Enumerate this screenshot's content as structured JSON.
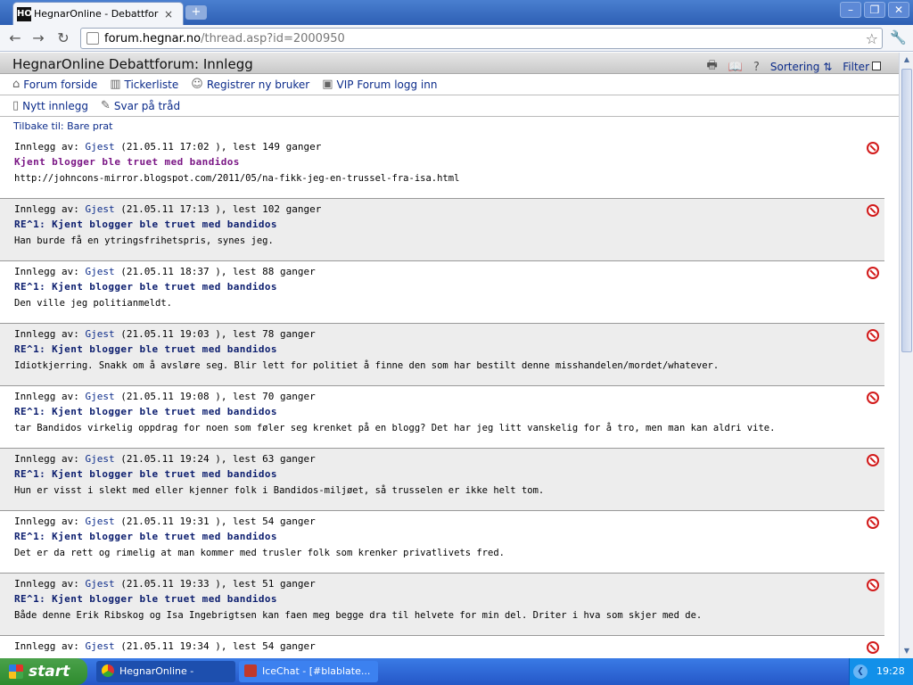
{
  "browser": {
    "tab_title": "HegnarOnline - Debattforum",
    "tab_favicon_text": "HO",
    "tab_close": "×",
    "new_tab": "+",
    "window_buttons": [
      "–",
      "❐",
      "✕"
    ],
    "back": "←",
    "forward": "→",
    "reload": "↻",
    "url_host": "forum.hegnar.no",
    "url_path": "/thread.asp?id=2000950",
    "star": "☆",
    "wrench": "🔧"
  },
  "forum": {
    "title": "HegnarOnline Debattforum: Innlegg",
    "sort_label": "Sortering",
    "filter_label": "Filter",
    "nav": [
      {
        "label": "Forum forside",
        "icon": "home-icon"
      },
      {
        "label": "Tickerliste",
        "icon": "chart-icon"
      },
      {
        "label": "Registrer ny bruker",
        "icon": "user-icon"
      },
      {
        "label": "VIP Forum logg inn",
        "icon": "vip-card-icon"
      }
    ],
    "actions": [
      {
        "label": "Nytt innlegg",
        "icon": "new-document-icon"
      },
      {
        "label": "Svar på tråd",
        "icon": "reply-icon"
      }
    ],
    "back_link": "Tilbake til: Bare prat"
  },
  "posts": [
    {
      "prefix": "Innlegg av: ",
      "author": "Gjest",
      "meta": " (21.05.11 17:02 ), lest 149 ganger",
      "title": "Kjent blogger ble truet med bandidos",
      "body": "http://johncons-mirror.blogspot.com/2011/05/na-fikk-jeg-en-trussel-fra-isa.html"
    },
    {
      "prefix": "Innlegg av: ",
      "author": "Gjest",
      "meta": " (21.05.11 17:13 ), lest 102 ganger",
      "title": "RE^1: Kjent blogger ble truet med bandidos",
      "body": "Han burde få en ytringsfrihetspris, synes jeg."
    },
    {
      "prefix": "Innlegg av: ",
      "author": "Gjest",
      "meta": " (21.05.11 18:37 ), lest 88 ganger",
      "title": "RE^1: Kjent blogger ble truet med bandidos",
      "body": "Den ville jeg politianmeldt."
    },
    {
      "prefix": "Innlegg av: ",
      "author": "Gjest",
      "meta": " (21.05.11 19:03 ), lest 78 ganger",
      "title": "RE^1: Kjent blogger ble truet med bandidos",
      "body": "Idiotkjerring. Snakk om å avsløre seg. Blir lett for politiet å finne den som har bestilt denne misshandelen/mordet/whatever."
    },
    {
      "prefix": "Innlegg av: ",
      "author": "Gjest",
      "meta": " (21.05.11 19:08 ), lest 70 ganger",
      "title": "RE^1: Kjent blogger ble truet med bandidos",
      "body": "tar Bandidos virkelig oppdrag for noen som føler seg krenket på en blogg? Det har jeg litt vanskelig for å tro, men man kan aldri vite."
    },
    {
      "prefix": "Innlegg av: ",
      "author": "Gjest",
      "meta": " (21.05.11 19:24 ), lest 63 ganger",
      "title": "RE^1: Kjent blogger ble truet med bandidos",
      "body": "Hun er visst i slekt med eller kjenner folk i Bandidos-miljøet, så trusselen er ikke helt tom."
    },
    {
      "prefix": "Innlegg av: ",
      "author": "Gjest",
      "meta": " (21.05.11 19:31 ), lest 54 ganger",
      "title": "RE^1: Kjent blogger ble truet med bandidos",
      "body": "Det er da rett og rimelig at man kommer med trusler folk som krenker privatlivets fred."
    },
    {
      "prefix": "Innlegg av: ",
      "author": "Gjest",
      "meta": " (21.05.11 19:33 ), lest 51 ganger",
      "title": "RE^1: Kjent blogger ble truet med bandidos",
      "body": "Både denne Erik Ribskog og Isa Ingebrigtsen kan faen meg begge dra til helvete for min del. Driter i hva som skjer med de."
    },
    {
      "prefix": "Innlegg av: ",
      "author": "Gjest",
      "meta": " (21.05.11 19:34 ), lest 54 ganger",
      "title": "",
      "body": ""
    }
  ],
  "taskbar": {
    "start": "start",
    "items": [
      "HegnarOnline - Debat...",
      "IceChat - [#blablate..."
    ],
    "clock": "19:28"
  },
  "colors": {
    "title_purple": "#7a1685",
    "title_navy": "#0b1d6e",
    "link_blue": "#0b2b8a",
    "block_red": "#d21a1a"
  }
}
